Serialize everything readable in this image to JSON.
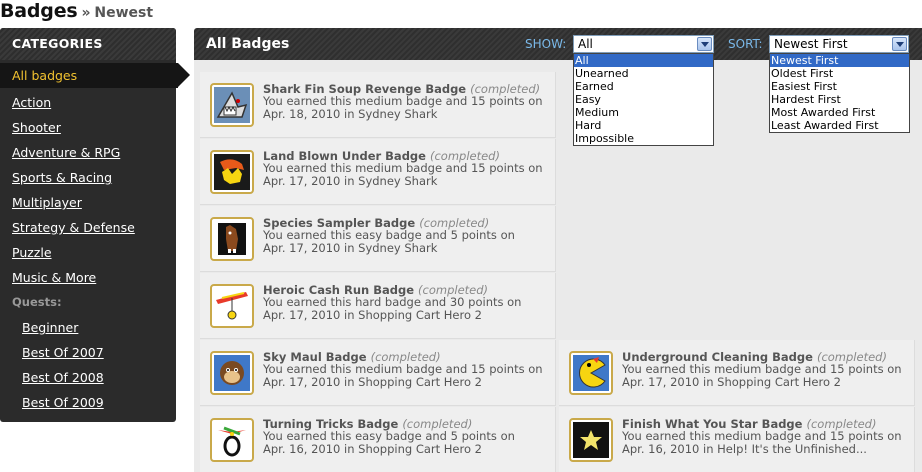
{
  "header": {
    "title": "Badges",
    "separator": "»",
    "subtitle": "Newest"
  },
  "sidebar": {
    "heading": "CATEGORIES",
    "items": [
      "All badges",
      "Action",
      "Shooter",
      "Adventure & RPG",
      "Sports & Racing",
      "Multiplayer",
      "Strategy & Defense",
      "Puzzle",
      "Music & More"
    ],
    "active_item": "All badges",
    "quests_label": "Quests:",
    "quest_items": [
      "Beginner",
      "Best Of 2007",
      "Best Of 2008",
      "Best Of 2009"
    ]
  },
  "main": {
    "heading": "All Badges",
    "show_label": "SHOW:",
    "show_value": "All",
    "show_options": [
      "All",
      "Unearned",
      "Earned",
      "Easy",
      "Medium",
      "Hard",
      "Impossible"
    ],
    "sort_label": "SORT:",
    "sort_value": "Newest First",
    "sort_options": [
      "Newest First",
      "Oldest First",
      "Easiest First",
      "Hardest First",
      "Most Awarded First",
      "Least Awarded First"
    ]
  },
  "badges": [
    {
      "name": "Shark Fin Soup Revenge Badge",
      "status": "(completed)",
      "desc_line1": "You earned this medium badge and 15 points on",
      "desc_line2": "Apr. 18, 2010 in Sydney Shark",
      "icon": "shark-badge-icon",
      "icon_bg": "#6b8fb7"
    },
    {
      "name": "Land Blown Under Badge",
      "status": "(completed)",
      "desc_line1": "You earned this medium badge and 15 points on",
      "desc_line2": "Apr. 17, 2010 in Sydney Shark",
      "icon": "explosion-badge-icon",
      "icon_bg": "#1a1a1a"
    },
    {
      "name": "Species Sampler Badge",
      "status": "(completed)",
      "desc_line1": "You earned this easy badge and 5 points on",
      "desc_line2": "Apr. 17, 2010 in Sydney Shark",
      "icon": "horse-badge-icon",
      "icon_bg": "#111111"
    },
    {
      "name": "Heroic Cash Run Badge",
      "status": "(completed)",
      "desc_line1": "You earned this hard badge and 30 points on",
      "desc_line2": "Apr. 17, 2010 in Shopping Cart Hero 2",
      "icon": "hang-glider-badge-icon",
      "icon_bg": "#ffffff"
    },
    {
      "name": "Sky Maul Badge",
      "status": "(completed)",
      "desc_line1": "You earned this medium badge and 15 points on",
      "desc_line2": "Apr. 17, 2010 in Shopping Cart Hero 2",
      "icon": "monkey-badge-icon",
      "icon_bg": "#3f78c8"
    },
    {
      "name": "Underground Cleaning Badge",
      "status": "(completed)",
      "desc_line1": "You earned this medium badge and 15 points on",
      "desc_line2": "Apr. 17, 2010 in Shopping Cart Hero 2",
      "icon": "pacman-badge-icon",
      "icon_bg": "#3f78c8"
    },
    {
      "name": "Turning Tricks Badge",
      "status": "(completed)",
      "desc_line1": "You earned this easy badge and 5 points on",
      "desc_line2": "Apr. 16, 2010 in Shopping Cart Hero 2",
      "icon": "propeller-badge-icon",
      "icon_bg": "#ffffff"
    },
    {
      "name": "Finish What You Star Badge",
      "status": "(completed)",
      "desc_line1": "You earned this medium badge and 15 points on",
      "desc_line2": "Apr. 16, 2010 in Help! It's the Unfinished...",
      "icon": "star-badge-icon",
      "icon_bg": "#111111"
    }
  ],
  "colors": {
    "accent_active": "#f2c230",
    "select_highlight": "#3169c6",
    "badge_frame": "#c9a94a"
  }
}
